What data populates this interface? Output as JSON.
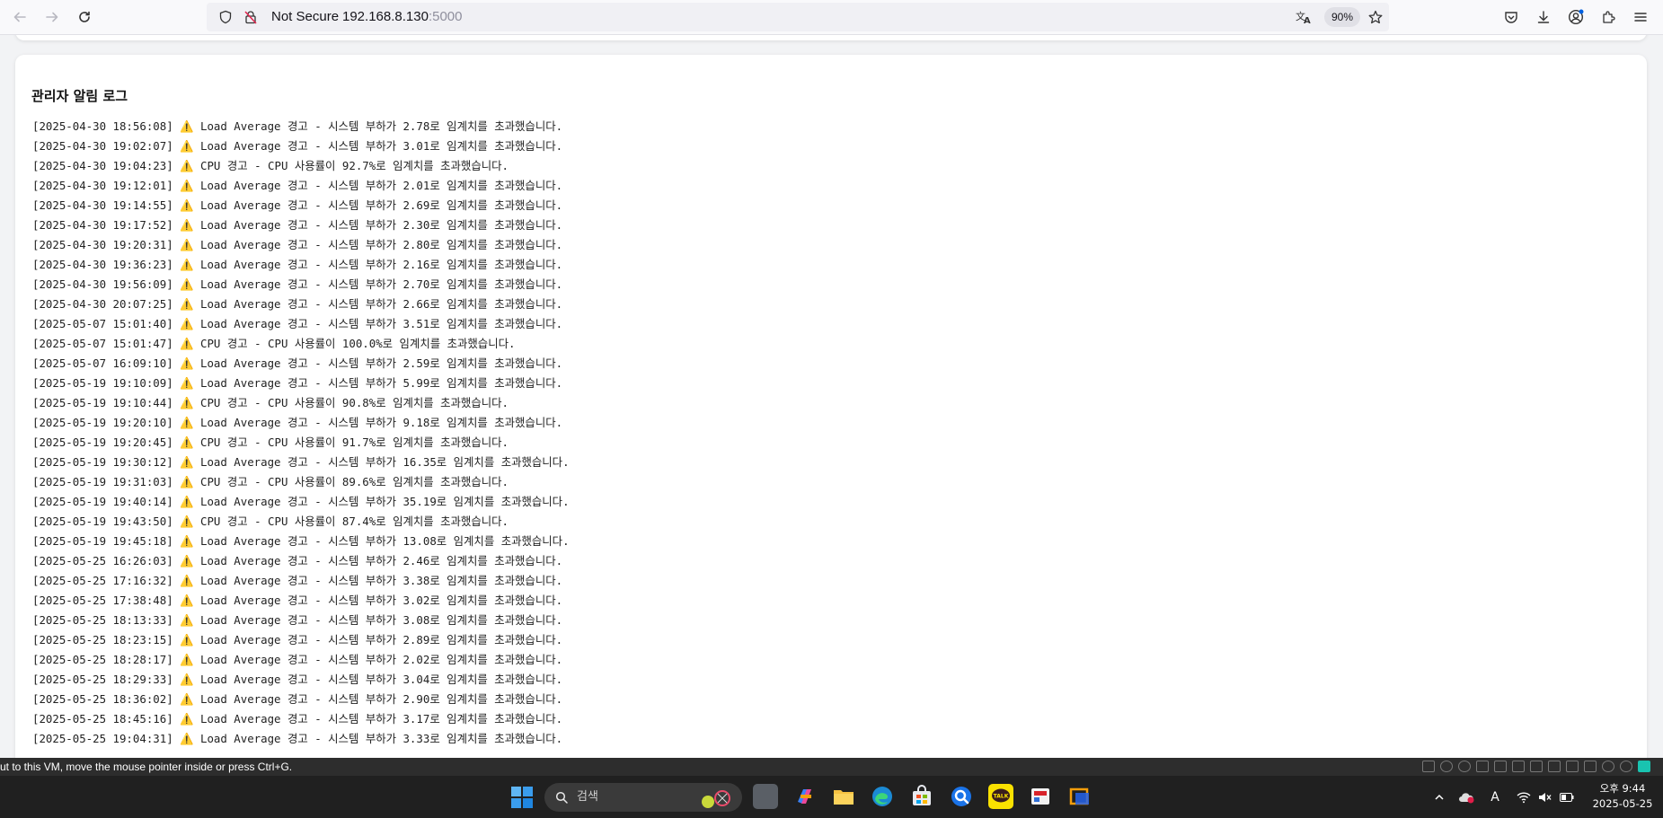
{
  "browser": {
    "security_label": "Not Secure",
    "url_host": "192.168.8.130",
    "url_port": ":5000",
    "zoom": "90%"
  },
  "page": {
    "title": "관리자 알림 로그",
    "logs": [
      "[2025-04-30 18:56:08] ⚠️ Load Average 경고 - 시스템 부하가 2.78로 임계치를 초과했습니다.",
      "[2025-04-30 19:02:07] ⚠️ Load Average 경고 - 시스템 부하가 3.01로 임계치를 초과했습니다.",
      "[2025-04-30 19:04:23] ⚠️ CPU 경고 - CPU 사용률이 92.7%로 임계치를 초과했습니다.",
      "[2025-04-30 19:12:01] ⚠️ Load Average 경고 - 시스템 부하가 2.01로 임계치를 초과했습니다.",
      "[2025-04-30 19:14:55] ⚠️ Load Average 경고 - 시스템 부하가 2.69로 임계치를 초과했습니다.",
      "[2025-04-30 19:17:52] ⚠️ Load Average 경고 - 시스템 부하가 2.30로 임계치를 초과했습니다.",
      "[2025-04-30 19:20:31] ⚠️ Load Average 경고 - 시스템 부하가 2.80로 임계치를 초과했습니다.",
      "[2025-04-30 19:36:23] ⚠️ Load Average 경고 - 시스템 부하가 2.16로 임계치를 초과했습니다.",
      "[2025-04-30 19:56:09] ⚠️ Load Average 경고 - 시스템 부하가 2.70로 임계치를 초과했습니다.",
      "[2025-04-30 20:07:25] ⚠️ Load Average 경고 - 시스템 부하가 2.66로 임계치를 초과했습니다.",
      "[2025-05-07 15:01:40] ⚠️ Load Average 경고 - 시스템 부하가 3.51로 임계치를 초과했습니다.",
      "[2025-05-07 15:01:47] ⚠️ CPU 경고 - CPU 사용률이 100.0%로 임계치를 초과했습니다.",
      "[2025-05-07 16:09:10] ⚠️ Load Average 경고 - 시스템 부하가 2.59로 임계치를 초과했습니다.",
      "[2025-05-19 19:10:09] ⚠️ Load Average 경고 - 시스템 부하가 5.99로 임계치를 초과했습니다.",
      "[2025-05-19 19:10:44] ⚠️ CPU 경고 - CPU 사용률이 90.8%로 임계치를 초과했습니다.",
      "[2025-05-19 19:20:10] ⚠️ Load Average 경고 - 시스템 부하가 9.18로 임계치를 초과했습니다.",
      "[2025-05-19 19:20:45] ⚠️ CPU 경고 - CPU 사용률이 91.7%로 임계치를 초과했습니다.",
      "[2025-05-19 19:30:12] ⚠️ Load Average 경고 - 시스템 부하가 16.35로 임계치를 초과했습니다.",
      "[2025-05-19 19:31:03] ⚠️ CPU 경고 - CPU 사용률이 89.6%로 임계치를 초과했습니다.",
      "[2025-05-19 19:40:14] ⚠️ Load Average 경고 - 시스템 부하가 35.19로 임계치를 초과했습니다.",
      "[2025-05-19 19:43:50] ⚠️ CPU 경고 - CPU 사용률이 87.4%로 임계치를 초과했습니다.",
      "[2025-05-19 19:45:18] ⚠️ Load Average 경고 - 시스템 부하가 13.08로 임계치를 초과했습니다.",
      "[2025-05-25 16:26:03] ⚠️ Load Average 경고 - 시스템 부하가 2.46로 임계치를 초과했습니다.",
      "[2025-05-25 17:16:32] ⚠️ Load Average 경고 - 시스템 부하가 3.38로 임계치를 초과했습니다.",
      "[2025-05-25 17:38:48] ⚠️ Load Average 경고 - 시스템 부하가 3.02로 임계치를 초과했습니다.",
      "[2025-05-25 18:13:33] ⚠️ Load Average 경고 - 시스템 부하가 3.08로 임계치를 초과했습니다.",
      "[2025-05-25 18:23:15] ⚠️ Load Average 경고 - 시스템 부하가 2.89로 임계치를 초과했습니다.",
      "[2025-05-25 18:28:17] ⚠️ Load Average 경고 - 시스템 부하가 2.02로 임계치를 초과했습니다.",
      "[2025-05-25 18:29:33] ⚠️ Load Average 경고 - 시스템 부하가 3.04로 임계치를 초과했습니다.",
      "[2025-05-25 18:36:02] ⚠️ Load Average 경고 - 시스템 부하가 2.90로 임계치를 초과했습니다.",
      "[2025-05-25 18:45:16] ⚠️ Load Average 경고 - 시스템 부하가 3.17로 임계치를 초과했습니다.",
      "[2025-05-25 19:04:31] ⚠️ Load Average 경고 - 시스템 부하가 3.33로 임계치를 초과했습니다."
    ]
  },
  "vm_status": {
    "message": "ut to this VM, move the mouse pointer inside or press Ctrl+G."
  },
  "taskbar": {
    "search_placeholder": "검색",
    "clock_time": "오후 9:44",
    "clock_date": "2025-05-25",
    "ime_indicator": "A"
  }
}
